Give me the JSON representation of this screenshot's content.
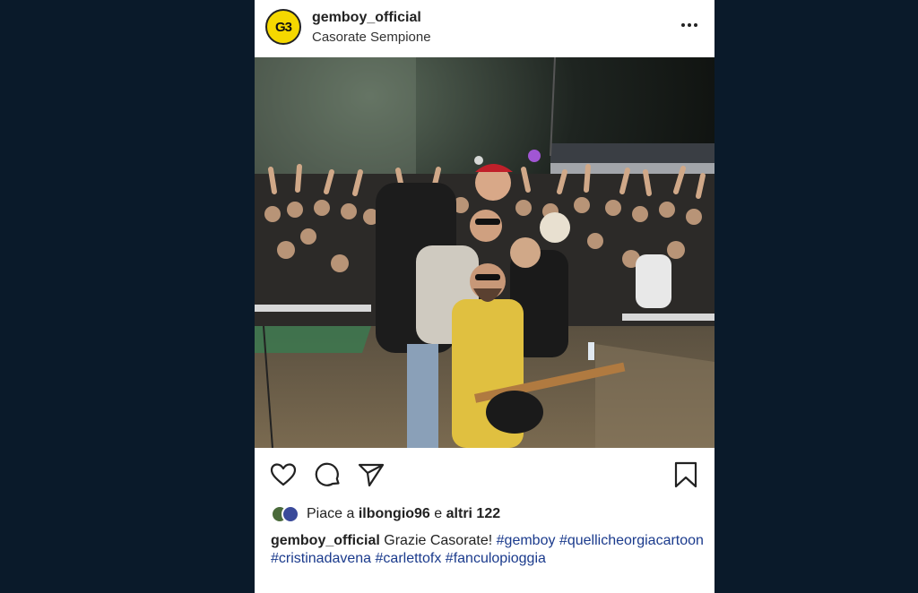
{
  "post": {
    "username": "gemboy_official",
    "location": "Casorate Sempione",
    "avatar_text": "G3",
    "likes": {
      "prefix": "Piace a",
      "user": "ilbongio96",
      "connector": "e",
      "others": "altri 122"
    },
    "caption": {
      "user": "gemboy_official",
      "text": "Grazie Casorate!",
      "hashtags": [
        "#gemboy",
        "#quellicheorgiacartoon",
        "#cristinadavena",
        "#carlettofx",
        "#fanculopioggia"
      ]
    }
  },
  "icons": {
    "like": "heart-icon",
    "comment": "comment-icon",
    "share": "send-icon",
    "save": "bookmark-icon",
    "more": "more-icon"
  },
  "colors": {
    "background": "#0a1a2a",
    "hashtag": "#1a3a8c",
    "avatar": "#f5d800"
  }
}
